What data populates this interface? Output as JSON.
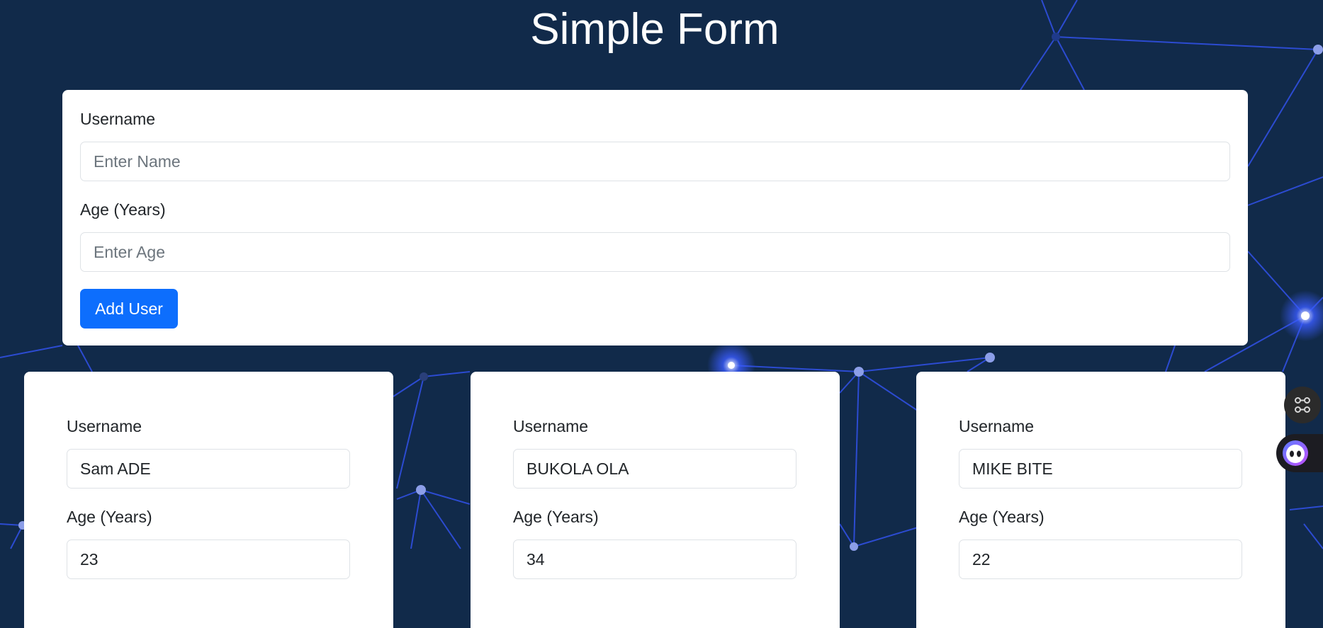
{
  "page": {
    "title": "Simple Form"
  },
  "form": {
    "username_label": "Username",
    "username_placeholder": "Enter Name",
    "username_value": "",
    "age_label": "Age (Years)",
    "age_placeholder": "Enter Age",
    "age_value": "",
    "submit_label": "Add User"
  },
  "users": [
    {
      "username_label": "Username",
      "username": "Sam ADE",
      "age_label": "Age (Years)",
      "age": "23"
    },
    {
      "username_label": "Username",
      "username": "BUKOLA OLA",
      "age_label": "Age (Years)",
      "age": "34"
    },
    {
      "username_label": "Username",
      "username": "MIKE BITE",
      "age_label": "Age (Years)",
      "age": "22"
    }
  ],
  "widgets": [
    {
      "icon": "command-icon"
    },
    {
      "icon": "assistant-bot-icon"
    }
  ],
  "colors": {
    "background": "#112a4a",
    "network_lines": "#2f4fe0",
    "network_nodes": "#8c9ee8",
    "primary_button": "#0d6efd",
    "card": "#ffffff"
  }
}
